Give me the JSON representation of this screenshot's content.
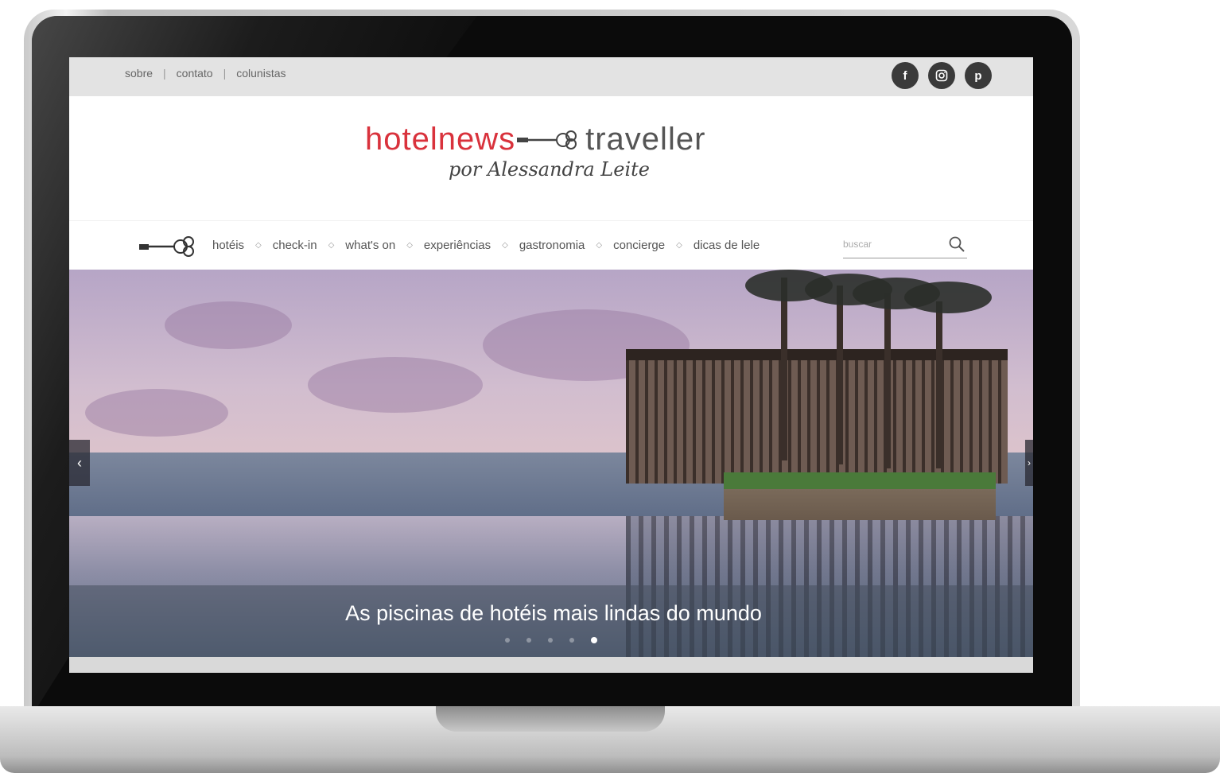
{
  "top_links": [
    "sobre",
    "contato",
    "colunistas"
  ],
  "separator": "|",
  "social": {
    "facebook": "f",
    "instagram": "instagram-icon",
    "pinterest": "p"
  },
  "logo": {
    "part1": "hotelnews",
    "part2": "traveller",
    "subtitle": "por Alessandra Leite"
  },
  "nav": {
    "items": [
      "hotéis",
      "check-in",
      "what's on",
      "experiências",
      "gastronomia",
      "concierge",
      "dicas de lele"
    ],
    "search_placeholder": "buscar"
  },
  "slider": {
    "caption": "As piscinas de hotéis mais lindas do mundo",
    "prev_label": "‹",
    "next_label": "›",
    "dots": 5,
    "active_dot": 5
  },
  "colors": {
    "brand_red": "#d9323c",
    "topbar_bg": "#e3e3e3",
    "social_bg": "#3a3a3a"
  }
}
